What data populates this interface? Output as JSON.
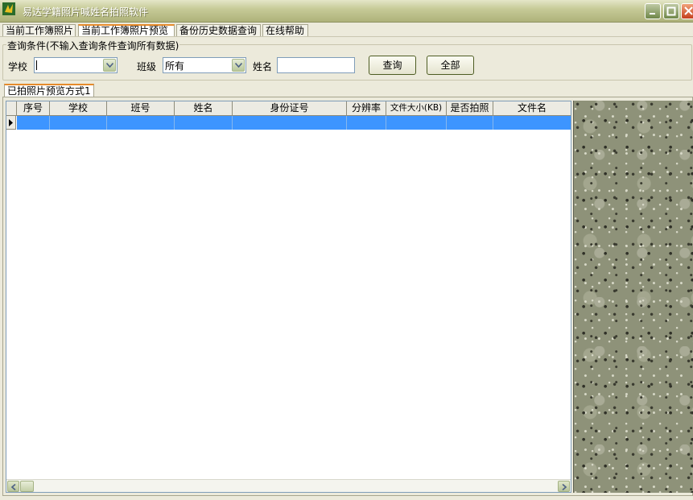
{
  "window": {
    "title": "易达学籍照片喊姓名拍照软件"
  },
  "tabs": [
    {
      "label": "当前工作簿照片",
      "active": false
    },
    {
      "label": "当前工作簿照片预览",
      "active": true
    },
    {
      "label": "备份历史数据查询",
      "active": false
    },
    {
      "label": "在线帮助",
      "active": false
    }
  ],
  "query": {
    "legend": "查询条件(不输入查询条件查询所有数据)",
    "school_label": "学校",
    "school_value": "",
    "class_label": "班级",
    "class_value": "所有",
    "name_label": "姓名",
    "name_value": "",
    "search_button": "查询",
    "all_button": "全部"
  },
  "subtab": {
    "label": "已拍照片预览方式1"
  },
  "grid": {
    "columns": [
      "序号",
      "学校",
      "班号",
      "姓名",
      "身份证号",
      "分辨率",
      "文件大小(KB)",
      "是否拍照",
      "文件名"
    ],
    "rows": [
      [
        "",
        "",
        "",
        "",
        "",
        "",
        "",
        "",
        ""
      ]
    ]
  },
  "colors": {
    "selection": "#3d95ff",
    "tab_accent": "#e68b2c",
    "window_bg": "#eceadb"
  }
}
